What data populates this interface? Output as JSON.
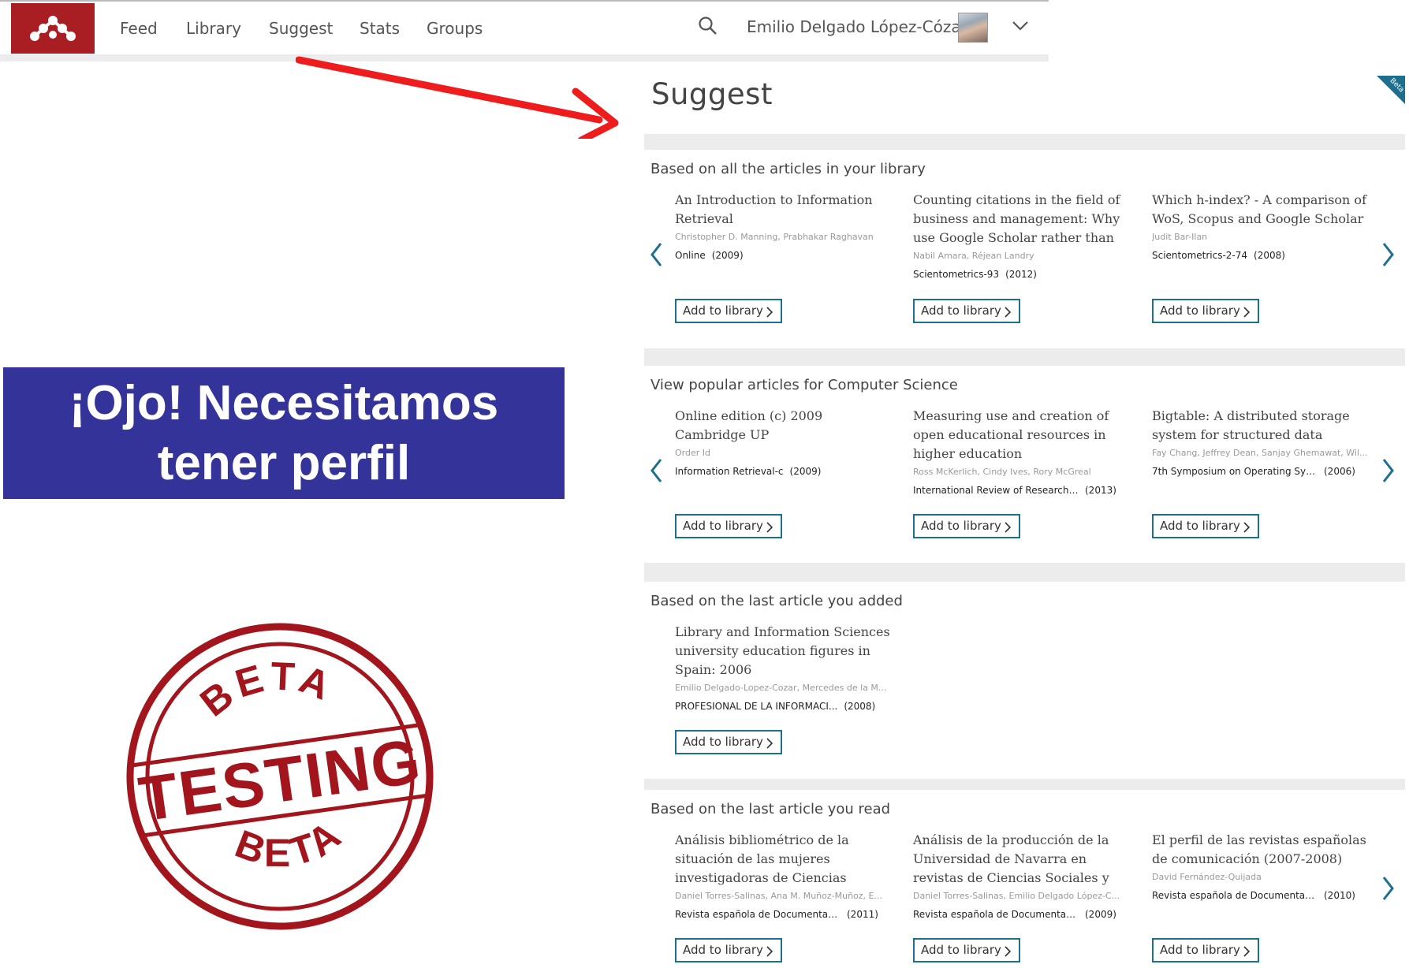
{
  "nav": {
    "items": [
      {
        "label": "Feed"
      },
      {
        "label": "Library"
      },
      {
        "label": "Suggest"
      },
      {
        "label": "Stats"
      },
      {
        "label": "Groups"
      }
    ],
    "user_name": "Emilio Delgado López-Cózar",
    "brand_color": "#a81e23"
  },
  "banner": {
    "line1": "¡Ojo! Necesitamos",
    "line2": "tener perfil",
    "background": "#333399"
  },
  "stamp": {
    "top": "BETA",
    "middle": "TESTING",
    "bottom": "BETA",
    "color": "#a3151c"
  },
  "main": {
    "title": "Suggest",
    "ribbon": "Beta",
    "add_label": "Add to library",
    "accent": "#1d6f8f",
    "sections": [
      {
        "title": "Based on all the articles in your library",
        "cards": [
          {
            "title": "An Introduction to Information Retrieval",
            "authors": "Christopher D. Manning, Prabhakar Raghavan",
            "source": "Online",
            "year": "(2009)"
          },
          {
            "title": "Counting citations in the field of business and management: Why use Google Scholar rather than the",
            "authors": "Nabil Amara, Réjean Landry",
            "source": "Scientometrics-93",
            "year": "(2012)"
          },
          {
            "title": "Which h-index? - A comparison of WoS, Scopus and Google Scholar",
            "authors": "Judit Bar-Ilan",
            "source": "Scientometrics-2-74",
            "year": "(2008)"
          }
        ]
      },
      {
        "title": "View popular articles for Computer Science",
        "cards": [
          {
            "title": "Online edition (c) 2009 Cambridge UP",
            "authors": "Order Id",
            "source": "Information Retrieval-c",
            "year": "(2009)"
          },
          {
            "title": "Measuring use and creation of open educational resources in higher education",
            "authors": "Ross McKerlich, Cindy Ives, Rory McGreal",
            "source": "International Review of Research in ...",
            "year": "(2013)"
          },
          {
            "title": "Bigtable: A distributed storage system for structured data",
            "authors": "Fay Chang, Jeffrey Dean, Sanjay Ghemawat, Wil...",
            "source": "7th Symposium on Operating Syste...",
            "year": "(2006)"
          }
        ]
      },
      {
        "title": "Based on the last article you added",
        "cards": [
          {
            "title": "Library and Information Sciences university education figures in Spain: 2006",
            "authors": "Emilio Delgado-Lopez-Cozar, Mercedes de la M...",
            "source": "PROFESIONAL DE LA INFORMACI...",
            "year": "(2008)"
          }
        ]
      },
      {
        "title": "Based on the last article you read",
        "cards": [
          {
            "title": "Análisis bibliométrico de la situación de las mujeres investigadoras de Ciencias Sociales",
            "authors": "Daniel Torres-Salinas, Ana M. Muñoz-Muñoz, E...",
            "source": "Revista española de Documentación...",
            "year": "(2011)"
          },
          {
            "title": "Análisis de la producción de la Universidad de Navarra en revistas de Ciencias Sociales y",
            "authors": "Daniel Torres-Salinas, Emilio Delgado López-C...",
            "source": "Revista española de Documentación...",
            "year": "(2009)"
          },
          {
            "title": "El perfil de las revistas españolas de comunicación (2007-2008)",
            "authors": "David Fernández-Quijada",
            "source": "Revista española de Documentación...",
            "year": "(2010)"
          }
        ]
      }
    ]
  }
}
